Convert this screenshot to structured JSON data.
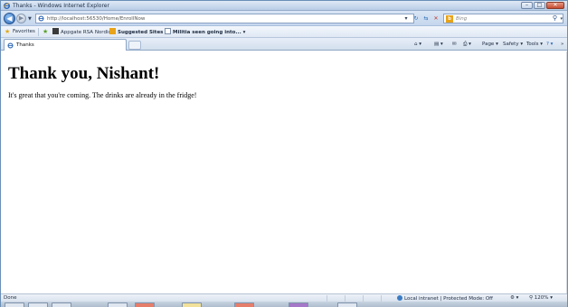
{
  "window": {
    "title": "Thanks - Windows Internet Explorer",
    "min_glyph": "–",
    "max_glyph": "□",
    "close_glyph": "✕"
  },
  "nav": {
    "back_glyph": "◀",
    "forward_glyph": "▶",
    "dropdown_glyph": "▼",
    "address_url": "http://localhost:56530/Home/EnrollNow",
    "compat_glyph": "▾",
    "refresh_glyph": "↻",
    "stop_glyph": "✕",
    "search_placeholder": "Bing",
    "search_logo": "b",
    "search_go_glyph": "⚲",
    "search_drop_glyph": "▾"
  },
  "favorites_bar": {
    "favorites_label": "Favorites",
    "items": [
      {
        "label": "Appgate RSA Nordic"
      },
      {
        "label": "Suggested Sites ▾"
      },
      {
        "label": "Militia seen going into... ▾"
      }
    ]
  },
  "tabs": [
    {
      "label": "Thanks"
    }
  ],
  "command_bar": {
    "home_glyph": "⌂ ▾",
    "feeds_glyph": "▤ ▾",
    "mail_glyph": "✉",
    "print_glyph": "⎙ ▾",
    "page_label": "Page ▾",
    "safety_label": "Safety ▾",
    "tools_label": "Tools ▾",
    "help_glyph": "? ▾",
    "more_glyph": "»"
  },
  "content": {
    "heading": "Thank you, Nishant!",
    "message": "It's great that you're coming. The drinks are already in the fridge!"
  },
  "status_bar": {
    "status": "Done",
    "zone": "Local intranet | Protected Mode: Off",
    "tools_glyph": "⚙ ▾",
    "zoom": "120%",
    "zoom_drop": "▾"
  },
  "colors": {
    "title_gradient": "#b9cde6",
    "ie_blue": "#2b66b6",
    "bing_orange": "#e8a31a"
  }
}
